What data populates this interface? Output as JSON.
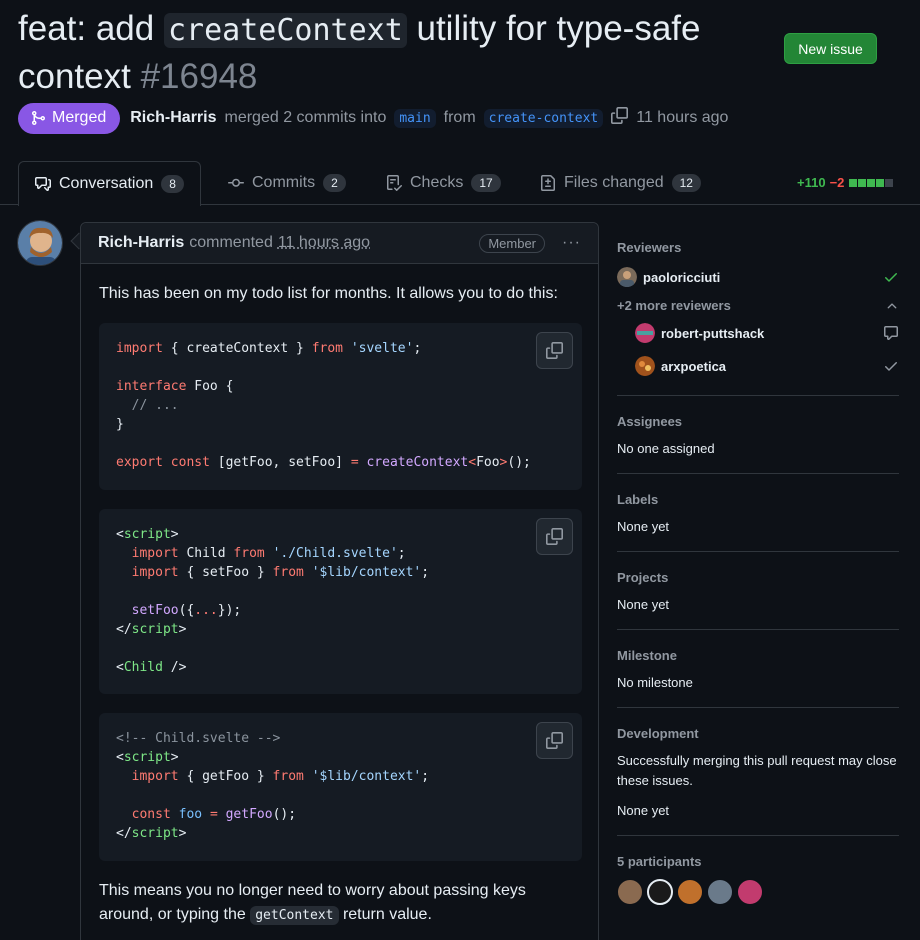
{
  "pr": {
    "title_prefix": "feat: add ",
    "title_code": "createContext",
    "title_suffix": " utility for type-safe context",
    "number": "#16948",
    "state": "Merged",
    "author": "Rich-Harris",
    "merge_text": "merged 2 commits into",
    "base_branch": "main",
    "from_text": "from",
    "head_branch": "create-context",
    "time": "11 hours ago"
  },
  "header": {
    "new_issue_label": "New issue"
  },
  "tabs": [
    {
      "label": "Conversation",
      "count": "8"
    },
    {
      "label": "Commits",
      "count": "2"
    },
    {
      "label": "Checks",
      "count": "17"
    },
    {
      "label": "Files changed",
      "count": "12"
    }
  ],
  "diffstat": {
    "additions": "+110",
    "deletions": "−2"
  },
  "comment": {
    "author": "Rich-Harris",
    "action": "commented",
    "time": "11 hours ago",
    "role": "Member",
    "intro": "This has been on my todo list for months. It allows you to do this:",
    "outro_before": "This means you no longer need to worry about passing keys around, or typing the ",
    "outro_code": "getContext",
    "outro_after": " return value."
  },
  "sidebar": {
    "reviewers_title": "Reviewers",
    "reviewers": [
      {
        "name": "paoloricciuti",
        "state": "approved"
      },
      {
        "name": "robert-puttshack",
        "state": "commented"
      },
      {
        "name": "arxpoetica",
        "state": "approved-old"
      }
    ],
    "more_reviewers": "+2 more reviewers",
    "assignees_title": "Assignees",
    "assignees_value": "No one assigned",
    "labels_title": "Labels",
    "labels_value": "None yet",
    "projects_title": "Projects",
    "projects_value": "None yet",
    "milestone_title": "Milestone",
    "milestone_value": "No milestone",
    "development_title": "Development",
    "development_text": "Successfully merging this pull request may close these issues.",
    "development_value": "None yet",
    "participants_title": "5 participants"
  },
  "colors": {
    "merged": "#8957e5",
    "success": "#238636",
    "add": "#3fb950",
    "del": "#f85149"
  }
}
